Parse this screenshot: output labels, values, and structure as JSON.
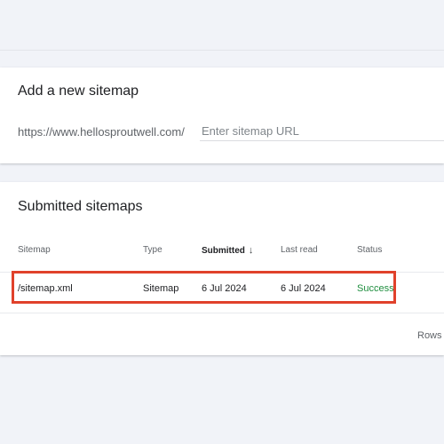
{
  "add_sitemap": {
    "title": "Add a new sitemap",
    "url_prefix": "https://www.hellosproutwell.com/",
    "input_value": "",
    "input_placeholder": "Enter sitemap URL"
  },
  "submitted_sitemaps": {
    "title": "Submitted sitemaps",
    "columns": [
      "Sitemap",
      "Type",
      "Submitted",
      "Last read",
      "Status"
    ],
    "sorted_column": "Submitted",
    "sort_icon": "arrow-down-icon",
    "rows": [
      {
        "sitemap": "/sitemap.xml",
        "type": "Sitemap",
        "submitted": "6 Jul 2024",
        "last_read": "6 Jul 2024",
        "status": "Success"
      }
    ],
    "footer_rows_label": "Rows"
  },
  "colors": {
    "page_background": "#f1f3f8",
    "card_background": "#ffffff",
    "success": "#1e8e3e",
    "highlight": "#e0412b"
  }
}
